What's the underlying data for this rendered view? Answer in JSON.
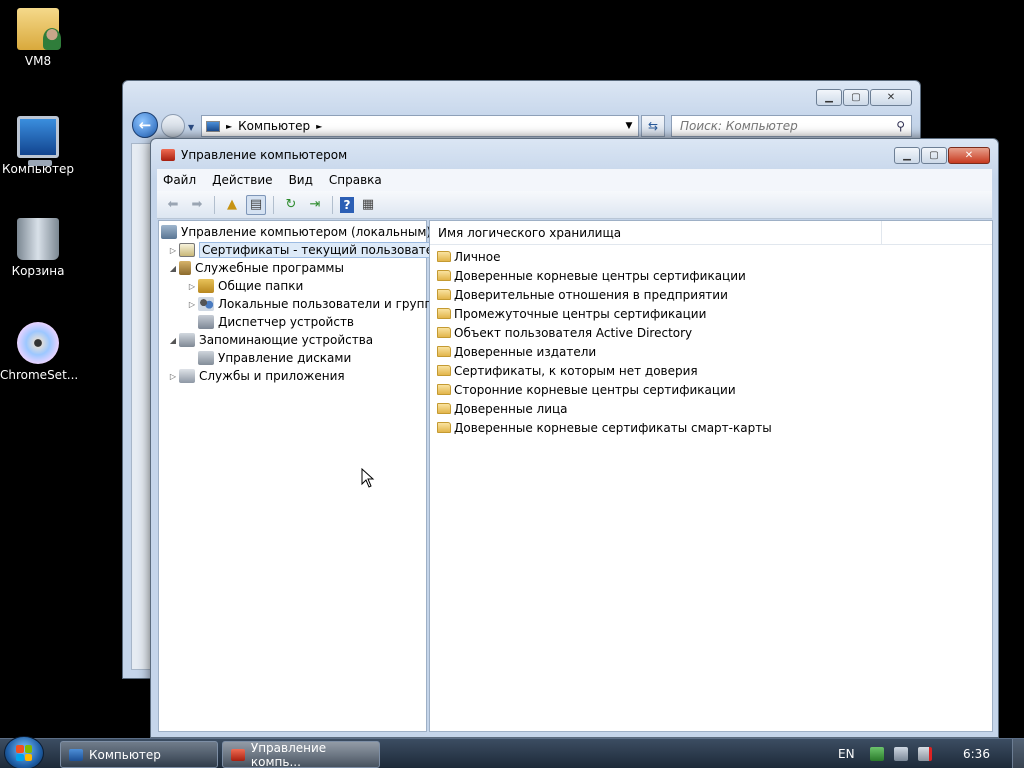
{
  "desktop": {
    "icons": [
      {
        "label": "VM8",
        "icon": "user-folder-icon"
      },
      {
        "label": "Компьютер",
        "icon": "computer-icon"
      },
      {
        "label": "Корзина",
        "icon": "recycle-bin-icon"
      },
      {
        "label": "ChromeSet...",
        "icon": "setup-cd-icon"
      }
    ]
  },
  "explorer": {
    "address": "Компьютер",
    "search_placeholder": "Поиск: Компьютер"
  },
  "mmc": {
    "title": "Управление компьютером",
    "menu": [
      "Файл",
      "Действие",
      "Вид",
      "Справка"
    ],
    "tree": [
      {
        "label": "Управление компьютером (локальным)",
        "icon": "computer-management-icon",
        "expander": "",
        "selected": false
      },
      {
        "label": "Сертификаты - текущий пользователь",
        "icon": "certificates-icon",
        "expander": "▷",
        "selected": true
      },
      {
        "label": "Служебные программы",
        "icon": "tools-icon",
        "expander": "◢",
        "selected": false
      },
      {
        "label": "Общие папки",
        "icon": "shared-folders-icon",
        "expander": "▷",
        "selected": false
      },
      {
        "label": "Локальные пользователи и группы",
        "icon": "users-groups-icon",
        "expander": "▷",
        "selected": false
      },
      {
        "label": "Диспетчер устройств",
        "icon": "device-manager-icon",
        "expander": "",
        "selected": false
      },
      {
        "label": "Запоминающие устройства",
        "icon": "storage-icon",
        "expander": "◢",
        "selected": false
      },
      {
        "label": "Управление дисками",
        "icon": "disk-management-icon",
        "expander": "",
        "selected": false
      },
      {
        "label": "Службы и приложения",
        "icon": "services-apps-icon",
        "expander": "▷",
        "selected": false
      }
    ],
    "list_header": "Имя логического хранилища",
    "stores": [
      "Личное",
      "Доверенные корневые центры сертификации",
      "Доверительные отношения в предприятии",
      "Промежуточные центры сертификации",
      "Объект пользователя Active Directory",
      "Доверенные издатели",
      "Сертификаты, к которым нет доверия",
      "Сторонние корневые центры сертификации",
      "Доверенные лица",
      "Доверенные корневые сертификаты смарт-карты"
    ]
  },
  "taskbar": {
    "buttons": [
      "Компьютер",
      "Управление компь..."
    ],
    "language": "EN",
    "time": "6:36"
  }
}
